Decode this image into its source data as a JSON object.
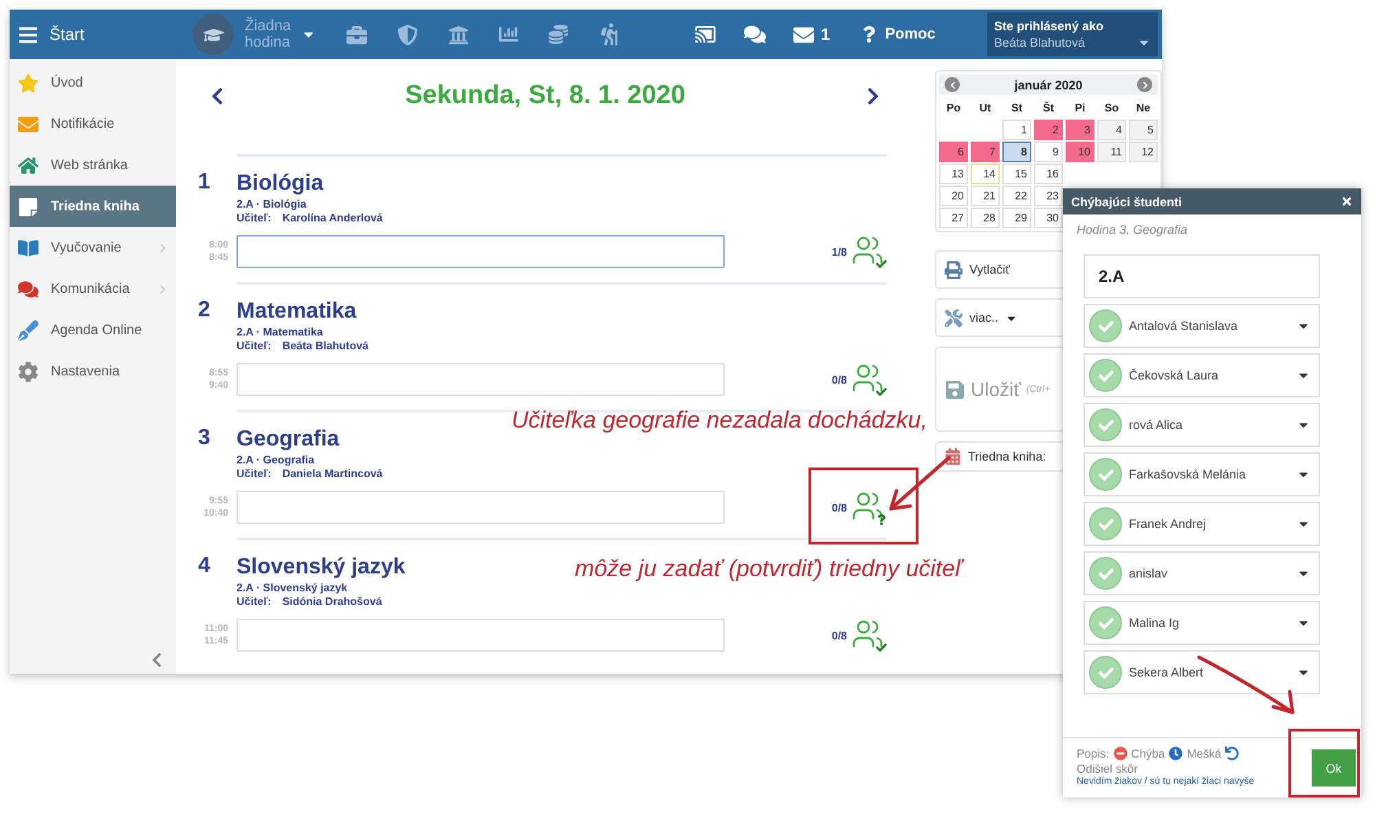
{
  "topbar": {
    "menu_label": "Štart",
    "lesson_select": "Žiadna hodina",
    "mail_count": "1",
    "help": "Pomoc",
    "login_caption": "Ste prihlásený ako",
    "user": "Beáta Blahutová"
  },
  "sidebar": {
    "items": [
      {
        "label": "Úvod",
        "selected": false,
        "submenu": false
      },
      {
        "label": "Notifikácie",
        "selected": false,
        "submenu": false
      },
      {
        "label": "Web stránka",
        "selected": false,
        "submenu": false
      },
      {
        "label": "Triedna kniha",
        "selected": true,
        "submenu": false
      },
      {
        "label": "Vyučovanie",
        "selected": false,
        "submenu": true
      },
      {
        "label": "Komunikácia",
        "selected": false,
        "submenu": true
      },
      {
        "label": "Agenda Online",
        "selected": false,
        "submenu": false
      },
      {
        "label": "Nastavenia",
        "selected": false,
        "submenu": false
      }
    ]
  },
  "day_title": "Sekunda, St, 8. 1. 2020",
  "lessons": [
    {
      "number": "1",
      "subject": "Biológia",
      "class_line": "2.A · Biológia",
      "teacher_label": "Učiteľ:",
      "teacher": "Karolína Anderlová",
      "start": "8:00",
      "end": "8:45",
      "focused": true,
      "count": "1/8",
      "kind": "confirmed"
    },
    {
      "number": "2",
      "subject": "Matematika",
      "class_line": "2.A · Matematika",
      "teacher_label": "Učiteľ:",
      "teacher": "Beáta Blahutová",
      "start": "8:55",
      "end": "9:40",
      "focused": false,
      "count": "0/8",
      "kind": "confirmed"
    },
    {
      "number": "3",
      "subject": "Geografia",
      "class_line": "2.A · Geografia",
      "teacher_label": "Učiteľ:",
      "teacher": "Daniela Martincová",
      "start": "9:55",
      "end": "10:40",
      "focused": false,
      "count": "0/8",
      "kind": "unknown"
    },
    {
      "number": "4",
      "subject": "Slovenský jazyk",
      "class_line": "2.A · Slovenský jazyk",
      "teacher_label": "Učiteľ:",
      "teacher": "Sidónia Drahošová",
      "start": "11:00",
      "end": "11:45",
      "focused": false,
      "count": "0/8",
      "kind": "confirmed"
    }
  ],
  "calendar": {
    "month": "január 2020",
    "weekdays": [
      "Po",
      "Ut",
      "St",
      "Št",
      "Pi",
      "So",
      "Ne"
    ],
    "weeks": [
      [
        {
          "day": "1",
          "kind": "normal"
        },
        {
          "day": "2",
          "kind": "marked"
        },
        {
          "day": "3",
          "kind": "marked"
        },
        {
          "day": "4",
          "kind": "weekend"
        },
        {
          "day": "5",
          "kind": "weekend"
        }
      ],
      [
        {
          "day": "6",
          "kind": "marked"
        },
        {
          "day": "7",
          "kind": "marked"
        },
        {
          "day": "8",
          "kind": "selected"
        },
        {
          "day": "9",
          "kind": "normal"
        },
        {
          "day": "10",
          "kind": "marked"
        },
        {
          "day": "11",
          "kind": "weekend"
        },
        {
          "day": "12",
          "kind": "weekend"
        }
      ],
      [
        {
          "day": "13",
          "kind": "normal"
        },
        {
          "day": "14",
          "kind": "today"
        },
        {
          "day": "15",
          "kind": "normal"
        },
        {
          "day": "16",
          "kind": "normal"
        }
      ],
      [
        {
          "day": "20",
          "kind": "normal"
        },
        {
          "day": "21",
          "kind": "normal"
        },
        {
          "day": "22",
          "kind": "normal"
        },
        {
          "day": "23",
          "kind": "normal"
        }
      ],
      [
        {
          "day": "27",
          "kind": "normal"
        },
        {
          "day": "28",
          "kind": "normal"
        },
        {
          "day": "29",
          "kind": "normal"
        },
        {
          "day": "30",
          "kind": "normal"
        }
      ]
    ]
  },
  "actions": {
    "print": "Vytlačiť",
    "more": "viac..",
    "save": "Uložiť",
    "save_hint": "(Ctrl+",
    "book": "Triedna kniha:"
  },
  "popup": {
    "title": "Chýbajúci študenti",
    "subtitle": "Hodina 3, Geografia",
    "class": "2.A",
    "students": [
      "Antalová Stanislava",
      "Čekovská Laura",
      "rová Alica",
      "Farkašovská Melánia",
      "Franek Andrej",
      "anislav",
      "Malina Ig",
      "Sekera Albert"
    ],
    "legend_label": "Popis:",
    "legend": [
      {
        "kind": "absent",
        "label": "Chýba"
      },
      {
        "kind": "late",
        "label": "Mešká"
      },
      {
        "kind": "left",
        "label": "Odišiel skôr"
      }
    ],
    "link": "Nevidím žiakov / sú tu nejakí žiaci navyše",
    "ok": "Ok"
  },
  "annotations": [
    "Učiteľka geografie nezadala dochádzku,",
    "môže ju zadať (potvrdiť) triedny učiteľ"
  ]
}
